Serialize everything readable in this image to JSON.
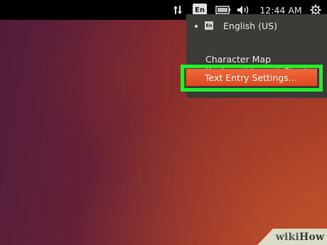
{
  "top_panel": {
    "language_indicator": "En",
    "clock": "12:44 AM",
    "icons": [
      "network-arrows-icon",
      "battery-icon",
      "volume-icon",
      "gear-icon"
    ]
  },
  "menu": {
    "active_layout": {
      "badge": "En",
      "label": "English (US)"
    },
    "items": [
      {
        "label": "Character Map"
      },
      {
        "label": "Keyboard Layout Chart"
      },
      {
        "label": "Text Entry Settings..."
      }
    ]
  },
  "highlight": {
    "color": "#21f02a"
  },
  "watermark": {
    "wiki": "wiki",
    "how": "How"
  }
}
